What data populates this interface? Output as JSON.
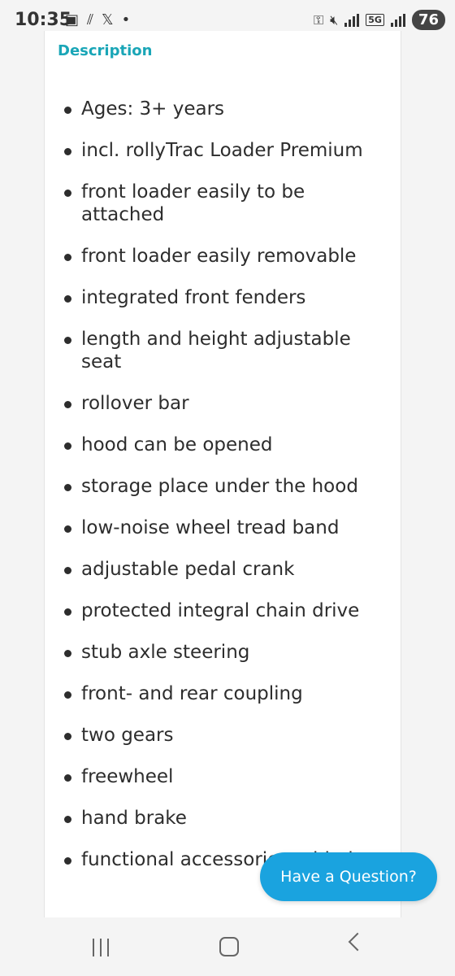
{
  "status_bar": {
    "time": "10:35",
    "network": "5G",
    "battery": "76"
  },
  "section": {
    "heading": "Description"
  },
  "features": [
    "Ages: 3+ years",
    "incl. rollyTrac Loader Premium",
    "front loader easily to be attached",
    "front loader easily removable",
    "integrated front fenders",
    "length and height adjustable seat",
    "rollover bar",
    "hood can be opened",
    "storage place under the hood",
    "low-noise wheel tread band",
    "adjustable pedal crank",
    "protected integral chain drive",
    "stub axle steering",
    "front- and rear coupling",
    "two gears",
    "freewheel",
    "hand brake",
    "functional accessories added"
  ],
  "chat": {
    "label": "Have a Question?"
  },
  "colors": {
    "heading": "#1aa6b7",
    "chat_button": "#1aa3df"
  }
}
